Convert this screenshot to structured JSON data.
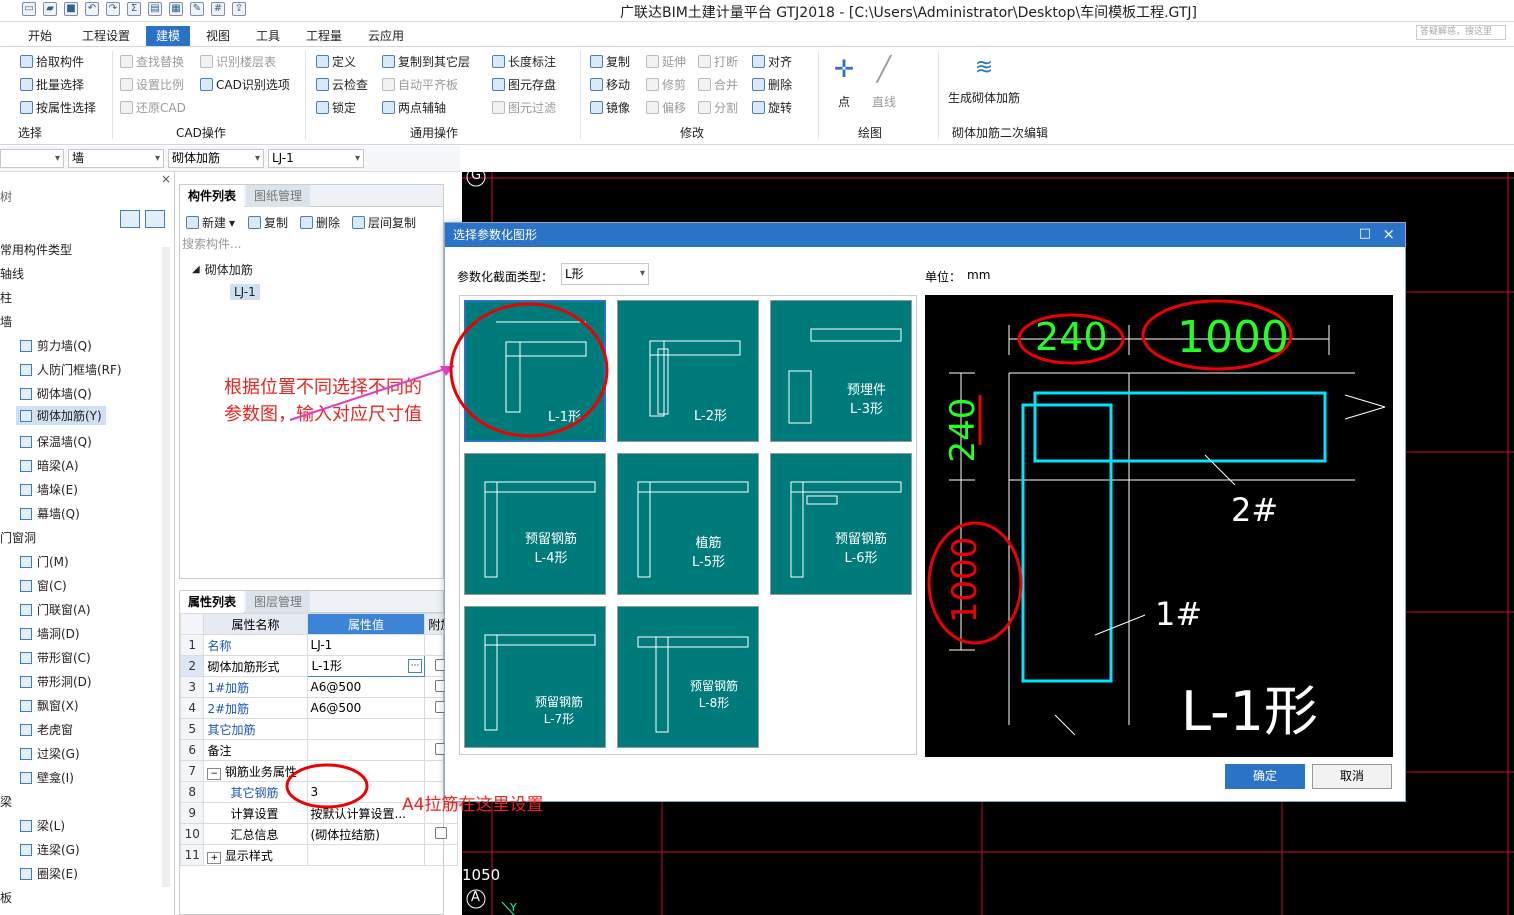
{
  "window": {
    "title": "广联达BIM土建计量平台 GTJ2018 - [C:\\Users\\Administrator\\Desktop\\车间模板工程.GTJ]",
    "search_placeholder": "答疑解惑，搜这里"
  },
  "tabs": [
    "开始",
    "工程设置",
    "建模",
    "视图",
    "工具",
    "工程量",
    "云应用"
  ],
  "ribbon": {
    "select_group": {
      "items": [
        "拾取构件",
        "批量选择",
        "按属性选择"
      ],
      "label": "选择"
    },
    "cad_group": {
      "items": [
        "查找替换",
        "识别楼层表",
        "设置比例",
        "CAD识别选项",
        "还原CAD"
      ],
      "label": "CAD操作"
    },
    "common_group": {
      "items": [
        "定义",
        "复制到其它层",
        "长度标注",
        "云检查",
        "自动平齐板",
        "图元存盘",
        "锁定",
        "两点辅轴",
        "图元过滤"
      ],
      "label": "通用操作"
    },
    "modify_group": {
      "items": [
        "复制",
        "延伸",
        "打断",
        "对齐",
        "移动",
        "修剪",
        "合并",
        "删除",
        "镜像",
        "偏移",
        "分割",
        "旋转"
      ],
      "label": "修改"
    },
    "draw_group": {
      "items": [
        "点",
        "直线"
      ],
      "label": "绘图"
    },
    "gen_group": {
      "items": [
        "生成砌体加筋"
      ],
      "label": "砌体加筋二次编辑"
    }
  },
  "filters": [
    "",
    "墙",
    "砌体加筋",
    "LJ-1"
  ],
  "tree": {
    "header": "树",
    "items": [
      "常用构件类型",
      "轴线",
      "柱",
      "墙",
      "剪力墙(Q)",
      "人防门框墙(RF)",
      "砌体墙(Q)",
      "砌体加筋(Y)",
      "保温墙(Q)",
      "暗梁(A)",
      "墙垛(E)",
      "幕墙(Q)",
      "门窗洞",
      "门(M)",
      "窗(C)",
      "门联窗(A)",
      "墙洞(D)",
      "带形窗(C)",
      "带形洞(D)",
      "飘窗(X)",
      "老虎窗",
      "过梁(G)",
      "壁龛(I)",
      "梁",
      "梁(L)",
      "连梁(G)",
      "圈梁(E)",
      "板"
    ]
  },
  "component_list": {
    "tabs": [
      "构件列表",
      "图纸管理"
    ],
    "toolbar": [
      "新建",
      "复制",
      "删除",
      "层间复制"
    ],
    "search_placeholder": "搜索构件...",
    "group": "砌体加筋",
    "item": "LJ-1"
  },
  "properties": {
    "tabs": [
      "属性列表",
      "图层管理"
    ],
    "headers": [
      "属性名称",
      "属性值",
      "附加"
    ],
    "rows": [
      {
        "n": "1",
        "name": "名称",
        "value": "LJ-1"
      },
      {
        "n": "2",
        "name": "砌体加筋形式",
        "value": "L-1形"
      },
      {
        "n": "3",
        "name": "1#加筋",
        "value": "A6@500"
      },
      {
        "n": "4",
        "name": "2#加筋",
        "value": "A6@500"
      },
      {
        "n": "5",
        "name": "其它加筋",
        "value": ""
      },
      {
        "n": "6",
        "name": "备注",
        "value": ""
      },
      {
        "n": "7",
        "name": "钢筋业务属性",
        "value": ""
      },
      {
        "n": "8",
        "name": "其它钢筋",
        "value": "3"
      },
      {
        "n": "9",
        "name": "计算设置",
        "value": "按默认计算设置..."
      },
      {
        "n": "10",
        "name": "汇总信息",
        "value": "(砌体拉结筋)"
      },
      {
        "n": "11",
        "name": "显示样式",
        "value": ""
      }
    ]
  },
  "dialog": {
    "title": "选择参数化图形",
    "type_label": "参数化截面类型：",
    "type_value": "L形",
    "unit_label": "单位：",
    "unit_value": "mm",
    "shapes": [
      "L-1形",
      "L-2形",
      "预埋件\nL-3形",
      "预留钢筋\nL-4形",
      "植筋\nL-5形",
      "预留钢筋\nL-6形",
      "预留钢筋\nL-7形",
      "预留钢筋\nL-8形"
    ],
    "preview": {
      "dim_top_left": "240",
      "dim_top_right": "1000",
      "dim_left_top": "240",
      "dim_left_bottom": "1000",
      "bar2": "2#",
      "bar1": "1#",
      "shape_name": "L-1形"
    },
    "ok": "确定",
    "cancel": "取消"
  },
  "cad_labels": {
    "g": "G",
    "a": "A",
    "coord": "1050",
    "y": "Y"
  },
  "annotations": {
    "note1_line1": "根据位置不同选择不同的",
    "note1_line2": "参数图，输入对应尺寸值",
    "note2": "A4拉筋在这里设置"
  }
}
